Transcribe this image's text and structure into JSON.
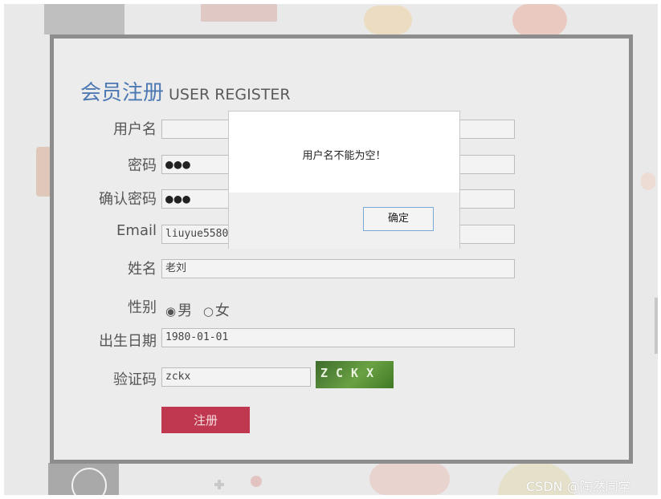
{
  "form": {
    "title_cn": "会员注册",
    "title_en": "USER REGISTER",
    "fields": [
      {
        "label": "用户名",
        "value": ""
      },
      {
        "label": "密码",
        "value": "●●●"
      },
      {
        "label": "确认密码",
        "value": "●●●"
      },
      {
        "label": "Email",
        "value": "liuyue5580"
      },
      {
        "label": "姓名",
        "value": "老刘"
      },
      {
        "label": "性别",
        "value": ""
      },
      {
        "label": "出生日期",
        "value": "1980-01-01"
      },
      {
        "label": "验证码",
        "value": "zckx"
      }
    ],
    "gender": {
      "male_label": "男",
      "female_label": "女",
      "selected_mark": "◉",
      "unselected_mark": "○"
    },
    "captcha_text": "ZCKX",
    "submit_label": "注册"
  },
  "dialog": {
    "message": "用户名不能为空！",
    "ok_label": "确定"
  },
  "watermark": "CSDN @陶然同学",
  "colors": {
    "title_blue": "#4d79b3",
    "submit_red": "#c0384f",
    "dialog_button_border": "#7aa8d6"
  },
  "icons": {
    "captcha": "captcha-image",
    "radio_selected": "radio-checked-icon",
    "radio_unselected": "radio-unchecked-icon"
  }
}
